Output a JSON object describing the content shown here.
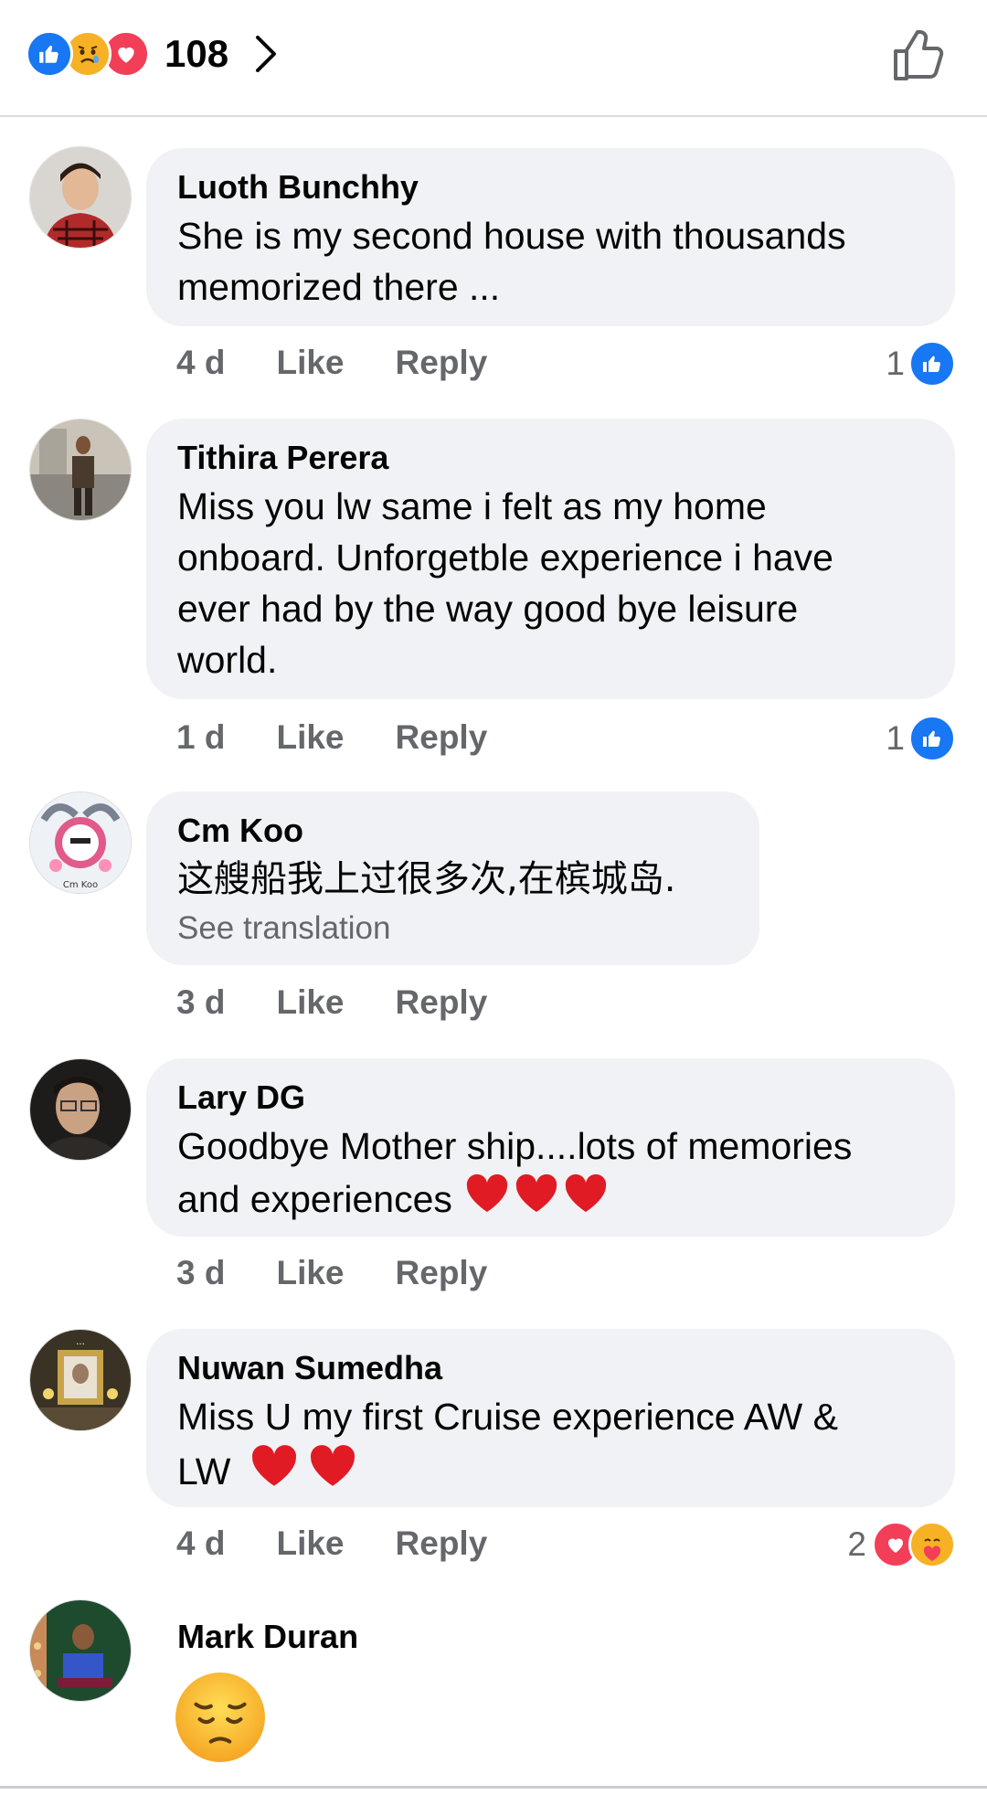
{
  "header": {
    "reaction_count": "108",
    "reaction_icons": [
      "like-icon",
      "sad-icon",
      "love-icon"
    ]
  },
  "comments": [
    {
      "author": "Luoth Bunchhy",
      "text_lines": [
        "She is my second house with thousands",
        "memorized there ..."
      ],
      "time": "4 d",
      "like_label": "Like",
      "reply_label": "Reply",
      "reaction_count": "1"
    },
    {
      "author": "Tithira Perera",
      "text_lines": [
        "Miss you lw same i felt as my home",
        "onboard. Unforgetble experience i have",
        "ever had by the way  good bye leisure",
        "world."
      ],
      "time": "1 d",
      "like_label": "Like",
      "reply_label": "Reply",
      "reaction_count": "1"
    },
    {
      "author": "Cm Koo",
      "text_lines": [
        "这艘船我上过很多次,在槟城岛."
      ],
      "see_translation": "See translation",
      "time": "3 d",
      "like_label": "Like",
      "reply_label": "Reply"
    },
    {
      "author": "Lary DG",
      "text_lines": [
        "Goodbye Mother ship....lots of memories",
        "and experiences"
      ],
      "time": "3 d",
      "like_label": "Like",
      "reply_label": "Reply"
    },
    {
      "author": "Nuwan Sumedha",
      "text_lines": [
        "Miss U my first Cruise experience AW  &",
        "LW"
      ],
      "time": "4 d",
      "like_label": "Like",
      "reply_label": "Reply",
      "reaction_count": "2"
    },
    {
      "author": "Mark Duran"
    }
  ],
  "colors": {
    "like_blue": "#1877f2",
    "love_red": "#f33e58",
    "bubble_bg": "#f0f2f5",
    "secondary_text": "#65676b"
  }
}
